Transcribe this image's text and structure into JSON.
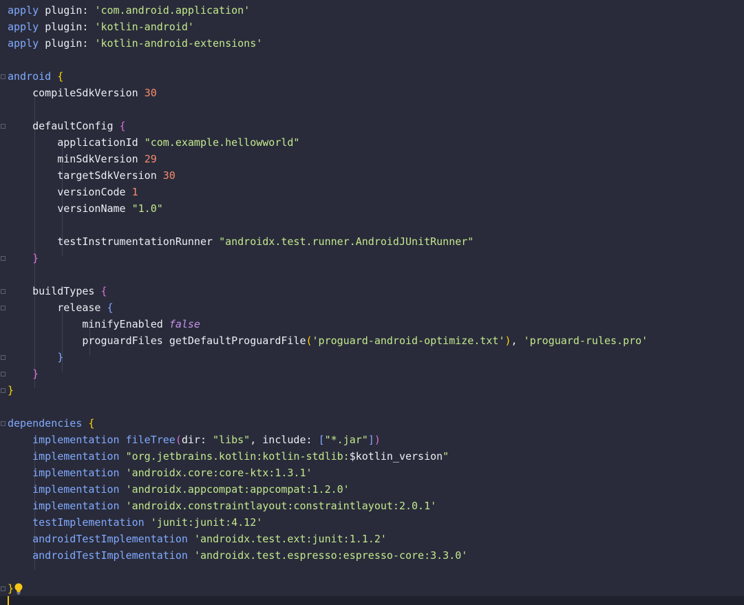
{
  "editor": {
    "file_language": "groovy",
    "lines": [
      [
        [
          "kw",
          "apply"
        ],
        [
          "p",
          " "
        ],
        [
          "id",
          "plugin:"
        ],
        [
          "p",
          " "
        ],
        [
          "str",
          "'com.android.application'"
        ]
      ],
      [
        [
          "kw",
          "apply"
        ],
        [
          "p",
          " "
        ],
        [
          "id",
          "plugin:"
        ],
        [
          "p",
          " "
        ],
        [
          "str",
          "'kotlin-android'"
        ]
      ],
      [
        [
          "kw",
          "apply"
        ],
        [
          "p",
          " "
        ],
        [
          "id",
          "plugin:"
        ],
        [
          "p",
          " "
        ],
        [
          "str",
          "'kotlin-android-extensions'"
        ]
      ],
      [],
      [
        [
          "kw",
          "android"
        ],
        [
          "p",
          " "
        ],
        [
          "b1",
          "{"
        ]
      ],
      [
        [
          "p",
          "    "
        ],
        [
          "id",
          "compileSdkVersion"
        ],
        [
          "p",
          " "
        ],
        [
          "num",
          "30"
        ]
      ],
      [],
      [
        [
          "p",
          "    "
        ],
        [
          "id",
          "defaultConfig"
        ],
        [
          "p",
          " "
        ],
        [
          "b2",
          "{"
        ]
      ],
      [
        [
          "p",
          "        "
        ],
        [
          "id",
          "applicationId"
        ],
        [
          "p",
          " "
        ],
        [
          "str",
          "\"com.example.hellowworld\""
        ]
      ],
      [
        [
          "p",
          "        "
        ],
        [
          "id",
          "minSdkVersion"
        ],
        [
          "p",
          " "
        ],
        [
          "num",
          "29"
        ]
      ],
      [
        [
          "p",
          "        "
        ],
        [
          "id",
          "targetSdkVersion"
        ],
        [
          "p",
          " "
        ],
        [
          "num",
          "30"
        ]
      ],
      [
        [
          "p",
          "        "
        ],
        [
          "id",
          "versionCode"
        ],
        [
          "p",
          " "
        ],
        [
          "num",
          "1"
        ]
      ],
      [
        [
          "p",
          "        "
        ],
        [
          "id",
          "versionName"
        ],
        [
          "p",
          " "
        ],
        [
          "str",
          "\"1.0\""
        ]
      ],
      [],
      [
        [
          "p",
          "        "
        ],
        [
          "id",
          "testInstrumentationRunner"
        ],
        [
          "p",
          " "
        ],
        [
          "str",
          "\"androidx.test.runner.AndroidJUnitRunner\""
        ]
      ],
      [
        [
          "p",
          "    "
        ],
        [
          "b2",
          "}"
        ]
      ],
      [],
      [
        [
          "p",
          "    "
        ],
        [
          "id",
          "buildTypes"
        ],
        [
          "p",
          " "
        ],
        [
          "b2",
          "{"
        ]
      ],
      [
        [
          "p",
          "        "
        ],
        [
          "id",
          "release"
        ],
        [
          "p",
          " "
        ],
        [
          "b3",
          "{"
        ]
      ],
      [
        [
          "p",
          "            "
        ],
        [
          "id",
          "minifyEnabled"
        ],
        [
          "p",
          " "
        ],
        [
          "bool",
          "false"
        ]
      ],
      [
        [
          "p",
          "            "
        ],
        [
          "id",
          "proguardFiles"
        ],
        [
          "p",
          " "
        ],
        [
          "id",
          "getDefaultProguardFile"
        ],
        [
          "b4",
          "("
        ],
        [
          "str",
          "'proguard-android-optimize.txt'"
        ],
        [
          "b4",
          ")"
        ],
        [
          "p",
          ", "
        ],
        [
          "str",
          "'proguard-rules.pro'"
        ]
      ],
      [
        [
          "p",
          "        "
        ],
        [
          "b3",
          "}"
        ]
      ],
      [
        [
          "p",
          "    "
        ],
        [
          "b2",
          "}"
        ]
      ],
      [
        [
          "b1",
          "}"
        ]
      ],
      [],
      [
        [
          "kw",
          "dependencies"
        ],
        [
          "p",
          " "
        ],
        [
          "b1",
          "{"
        ]
      ],
      [
        [
          "p",
          "    "
        ],
        [
          "impl",
          "implementation"
        ],
        [
          "p",
          " "
        ],
        [
          "fn",
          "fileTree"
        ],
        [
          "b2",
          "("
        ],
        [
          "id",
          "dir:"
        ],
        [
          "p",
          " "
        ],
        [
          "str",
          "\"libs\""
        ],
        [
          "p",
          ", "
        ],
        [
          "id",
          "include:"
        ],
        [
          "p",
          " "
        ],
        [
          "b3",
          "["
        ],
        [
          "str",
          "\"*.jar\""
        ],
        [
          "b3",
          "]"
        ],
        [
          "b2",
          ")"
        ]
      ],
      [
        [
          "p",
          "    "
        ],
        [
          "impl",
          "implementation"
        ],
        [
          "p",
          " "
        ],
        [
          "str",
          "\"org.jetbrains.kotlin:kotlin-stdlib:"
        ],
        [
          "id",
          "$kotlin_version"
        ],
        [
          "str",
          "\""
        ]
      ],
      [
        [
          "p",
          "    "
        ],
        [
          "impl",
          "implementation"
        ],
        [
          "p",
          " "
        ],
        [
          "str",
          "'androidx.core:core-ktx:1.3.1'"
        ]
      ],
      [
        [
          "p",
          "    "
        ],
        [
          "impl",
          "implementation"
        ],
        [
          "p",
          " "
        ],
        [
          "str",
          "'androidx.appcompat:appcompat:1.2.0'"
        ]
      ],
      [
        [
          "p",
          "    "
        ],
        [
          "impl",
          "implementation"
        ],
        [
          "p",
          " "
        ],
        [
          "str",
          "'androidx.constraintlayout:constraintlayout:2.0.1'"
        ]
      ],
      [
        [
          "p",
          "    "
        ],
        [
          "impl",
          "testImplementation"
        ],
        [
          "p",
          " "
        ],
        [
          "str",
          "'junit:junit:4.12'"
        ]
      ],
      [
        [
          "p",
          "    "
        ],
        [
          "impl",
          "androidTestImplementation"
        ],
        [
          "p",
          " "
        ],
        [
          "str",
          "'androidx.test.ext:junit:1.1.2'"
        ]
      ],
      [
        [
          "p",
          "    "
        ],
        [
          "impl",
          "androidTestImplementation"
        ],
        [
          "p",
          " "
        ],
        [
          "str",
          "'androidx.test.espresso:espresso-core:3.3.0'"
        ]
      ],
      [],
      [
        [
          "b1",
          "}"
        ]
      ]
    ]
  },
  "colors": {
    "background": "#292b3a",
    "keyword": "#82aaff",
    "string": "#c3e88d",
    "number": "#f78c6c",
    "bracket_level_1": "#ffd700",
    "bracket_level_2": "#da70d6",
    "bracket_level_3": "#82aaff",
    "caret": "#ffcc00"
  },
  "icons": {
    "intention": "lightbulb-icon"
  }
}
